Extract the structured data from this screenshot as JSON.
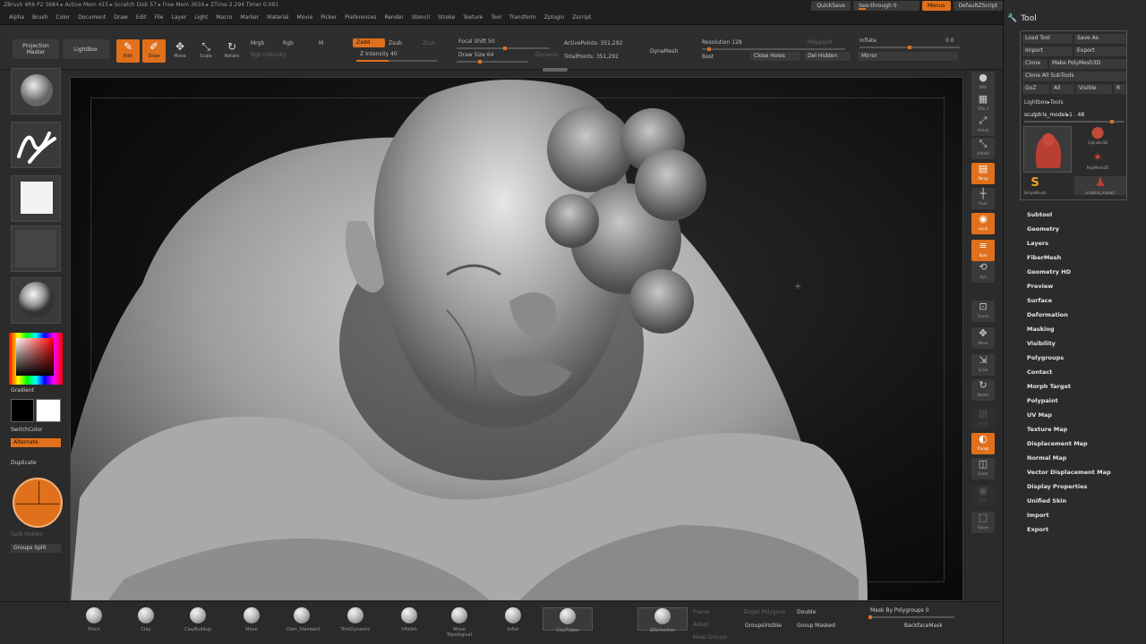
{
  "titlebar": {
    "info": "ZBrush 4R6 P2    3684    ▸ Active Mem 415  ▸ Scratch Disk 57  ▸ Free Mem 3659  ▸ ZTime 2.294 Timer 0.081",
    "menus": [
      "Alpha",
      "Brush",
      "Color",
      "Document",
      "Draw",
      "Edit",
      "File",
      "Layer",
      "Light",
      "Macro",
      "Marker",
      "Material",
      "Movie",
      "Picker",
      "Preferences",
      "Render",
      "Stencil",
      "Stroke",
      "Texture",
      "Tool",
      "Transform",
      "Zplugin",
      "Zscript"
    ],
    "quicksave": "QuickSave",
    "see_through": "See-through  0",
    "menus_btn": "Menus",
    "script_btn": "DefaultZScript"
  },
  "topshelf": {
    "projection_master": "Projection Master",
    "lightbox": "LightBox",
    "edit": "Edit",
    "draw": "Draw",
    "move": "Move",
    "scale": "Scale",
    "rotate": "Rotate",
    "mrgb": "Mrgb",
    "rgb": "Rgb",
    "m": "M",
    "rgb_intensity": "Rgb Intensity",
    "zadd": "Zadd",
    "zsub": "Zsub",
    "zcut": "Zcut",
    "z_intensity": "Z Intensity 40",
    "focal_shift": "Focal Shift  50",
    "draw_size": "Draw Size 64",
    "dynamic": "Dynamic",
    "active_points": "ActivePoints: 351,292",
    "total_points": "TotalPoints: 351,292",
    "dynamesh": "DynaMesh",
    "resolution": "Resolution 128",
    "best": "Best",
    "close_holes": "Close Holes",
    "del_hidden": "Del Hidden",
    "polypaint": "Polypaint",
    "inflate": "Inflate",
    "inflate_value": "0 0",
    "mirror": "Mirror",
    "z_intensity_level": 0.4,
    "focal_shift_level": 0.5,
    "draw_size_level": 0.3
  },
  "leftshelf": {
    "gradient": "Gradient",
    "switch_color": "SwitchColor",
    "alternate": "Alternate",
    "duplicate": "Duplicate",
    "split_hidden": "Split Hidden",
    "groups_split": "Groups Split"
  },
  "rightshelf": {
    "items": [
      {
        "icon": "●",
        "cap": "BPR"
      },
      {
        "icon": "▦",
        "cap": "SPix 3"
      },
      {
        "icon": "⤢",
        "cap": "Actual"
      },
      {
        "icon": "⤡",
        "cap": "AAHalf"
      },
      {
        "icon": "▤",
        "cap": "Persp"
      },
      {
        "icon": "┼",
        "cap": "Floor"
      },
      {
        "icon": "◉",
        "cap": "Local"
      },
      {
        "icon": "≡",
        "cap": "Sym"
      },
      {
        "icon": "⟲",
        "cap": "Xyz"
      },
      {
        "icon": "⊡",
        "cap": "Frame"
      },
      {
        "icon": "✥",
        "cap": "Move"
      },
      {
        "icon": "⇲",
        "cap": "Scale"
      },
      {
        "icon": "↻",
        "cap": "Rotate"
      },
      {
        "icon": "▥",
        "cap": "PolyF"
      },
      {
        "icon": "◐",
        "cap": "Transp"
      },
      {
        "icon": "◫",
        "cap": "Ghost"
      },
      {
        "icon": "▣",
        "cap": "Solo"
      },
      {
        "icon": "⬚",
        "cap": "Xpose"
      }
    ]
  },
  "toolpanel": {
    "title": "Tool",
    "load_tool": "Load Tool",
    "save_as": "Save As",
    "import": "Import",
    "export": "Export",
    "clone": "Clone",
    "make_polymesh": "Make PolyMesh3D",
    "clone_all": "Clone All SubTools",
    "goz": "GoZ",
    "all": "All",
    "visible": "Visible",
    "r": "R",
    "lightbox_tools": "Lightbox▸Tools",
    "current_tool": "sculptris_model▸1 . 48",
    "cylinder3d": "Cylinder3D",
    "polymesh3d": "PolyMesh3D",
    "simplebrush": "SimpleBrush",
    "sculptris_model": "sculptris_model1",
    "subpalettes": [
      "Subtool",
      "Geometry",
      "Layers",
      "FiberMesh",
      "Geometry HD",
      "Preview",
      "Surface",
      "Deformation",
      "Masking",
      "Visibility",
      "Polygroups",
      "Contact",
      "Morph Target",
      "Polypaint",
      "UV Map",
      "Texture Map",
      "Displacement Map",
      "Normal Map",
      "Vector Displacement Map",
      "Display Properties",
      "Unified Skin",
      "Import",
      "Export"
    ]
  },
  "bottomshelf": {
    "brushes": [
      "Pinch",
      "Clay",
      "ClayBuildup",
      "Move",
      "Dam_Standard",
      "TrimDynamic",
      "hPolish",
      "Move Topological",
      "Inflat",
      "ClayTubes"
    ],
    "framed_brush": "ClayTubes",
    "zremesher": "ZRemesher",
    "frame": "Frame",
    "target_polygons": "Target Polygons",
    "adapt": "Adapt",
    "keep_groups": "Keep Groups",
    "double": "Double",
    "groups_visible": "GroupsVisible",
    "group_masked": "Group Masked",
    "mask_by_polygroups": "Mask By Polygroups 0",
    "backfacemask": "BackfaceMask"
  }
}
